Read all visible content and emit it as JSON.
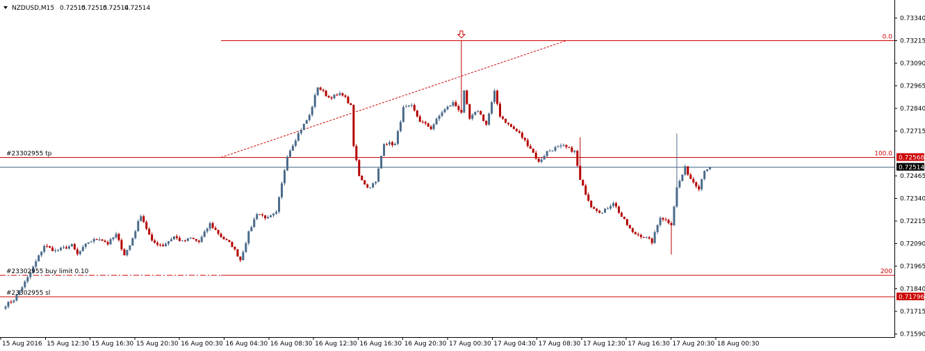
{
  "chart_data": {
    "type": "candlestick",
    "symbol_title": "NZDUSD,M15",
    "ohlc_readout": [
      "0.72515",
      "0.72515",
      "0.72514",
      "0.72514"
    ],
    "ylim": [
      0.7159,
      0.7337
    ],
    "y_ticks": [
      "0.73340",
      "0.73215",
      "0.73090",
      "0.72965",
      "0.72840",
      "0.72715",
      "0.72465",
      "0.72340",
      "0.72215",
      "0.72090",
      "0.71965",
      "0.71840",
      "0.71715",
      "0.71590"
    ],
    "x_ticks": [
      "15 Aug 2016",
      "15 Aug 12:30",
      "15 Aug 16:30",
      "15 Aug 20:30",
      "16 Aug 00:30",
      "16 Aug 04:30",
      "16 Aug 08:30",
      "16 Aug 12:30",
      "16 Aug 16:30",
      "16 Aug 20:30",
      "17 Aug 00:30",
      "17 Aug 04:30",
      "17 Aug 08:30",
      "17 Aug 12:30",
      "17 Aug 16:30",
      "17 Aug 20:30",
      "18 Aug 00:30"
    ],
    "bar_count": 256,
    "path": [
      [
        0,
        0.7175
      ],
      [
        3,
        0.7178
      ],
      [
        8,
        0.719
      ],
      [
        14,
        0.7208
      ],
      [
        18,
        0.7205
      ],
      [
        24,
        0.7208
      ],
      [
        26,
        0.7203
      ],
      [
        30,
        0.721
      ],
      [
        34,
        0.7212
      ],
      [
        37,
        0.7209
      ],
      [
        40,
        0.7214
      ],
      [
        43,
        0.7203
      ],
      [
        45,
        0.7208
      ],
      [
        49,
        0.7225
      ],
      [
        53,
        0.721
      ],
      [
        57,
        0.7208
      ],
      [
        61,
        0.7213
      ],
      [
        64,
        0.721
      ],
      [
        67,
        0.7212
      ],
      [
        70,
        0.721
      ],
      [
        74,
        0.722
      ],
      [
        78,
        0.7213
      ],
      [
        82,
        0.7208
      ],
      [
        85,
        0.72
      ],
      [
        88,
        0.7215
      ],
      [
        91,
        0.7226
      ],
      [
        95,
        0.7223
      ],
      [
        98,
        0.7226
      ],
      [
        102,
        0.7258
      ],
      [
        106,
        0.727
      ],
      [
        110,
        0.728
      ],
      [
        113,
        0.7296
      ],
      [
        117,
        0.729
      ],
      [
        122,
        0.7292
      ],
      [
        125,
        0.7285
      ],
      [
        126,
        0.7263
      ],
      [
        128,
        0.7247
      ],
      [
        131,
        0.724
      ],
      [
        134,
        0.7243
      ],
      [
        137,
        0.7265
      ],
      [
        141,
        0.7264
      ],
      [
        144,
        0.7284
      ],
      [
        147,
        0.7285
      ],
      [
        150,
        0.7277
      ],
      [
        154,
        0.7273
      ],
      [
        158,
        0.7282
      ],
      [
        162,
        0.7287
      ],
      [
        165,
        0.7282
      ],
      [
        166,
        0.7293
      ],
      [
        168,
        0.7278
      ],
      [
        171,
        0.7283
      ],
      [
        174,
        0.7275
      ],
      [
        177,
        0.7293
      ],
      [
        179,
        0.728
      ],
      [
        182,
        0.7275
      ],
      [
        186,
        0.727
      ],
      [
        190,
        0.7262
      ],
      [
        193,
        0.7254
      ],
      [
        196,
        0.726
      ],
      [
        199,
        0.7262
      ],
      [
        202,
        0.7263
      ],
      [
        206,
        0.726
      ],
      [
        208,
        0.7244
      ],
      [
        212,
        0.723
      ],
      [
        216,
        0.7226
      ],
      [
        220,
        0.7232
      ],
      [
        223,
        0.7224
      ],
      [
        227,
        0.7215
      ],
      [
        231,
        0.7213
      ],
      [
        234,
        0.721
      ],
      [
        237,
        0.7224
      ],
      [
        241,
        0.722
      ],
      [
        243,
        0.724
      ],
      [
        246,
        0.7251
      ],
      [
        248,
        0.7245
      ],
      [
        251,
        0.724
      ],
      [
        253,
        0.725
      ],
      [
        255,
        0.72514
      ]
    ],
    "spikes": [
      [
        165,
        0.73215
      ],
      [
        241,
        0.7203
      ],
      [
        243,
        0.727
      ],
      [
        208,
        0.7268
      ]
    ],
    "bull_color": "#4a6a8a",
    "bear_color": "#b40000",
    "price_line": {
      "label": "0.72514",
      "value": 0.72514,
      "color": "#4a6a8a"
    },
    "take_profit": {
      "text": "#23302955 tp",
      "tag": "0.72568",
      "value": 0.72568
    },
    "stop_loss": {
      "text": "#23302955 sl",
      "tag": "0.71796",
      "value": 0.71796
    },
    "buy_limit": {
      "text": "#23302955 buy limit 0.10",
      "value": 0.71915
    },
    "fibo": [
      {
        "label": "0.0",
        "value": 0.73215
      },
      {
        "label": "100.0",
        "value": 0.72568
      },
      {
        "label": "200",
        "value": 0.71915
      }
    ],
    "trendline": {
      "from": [
        80,
        0.72568
      ],
      "to": [
        205,
        0.73215
      ]
    },
    "arrow_bar": 165
  }
}
